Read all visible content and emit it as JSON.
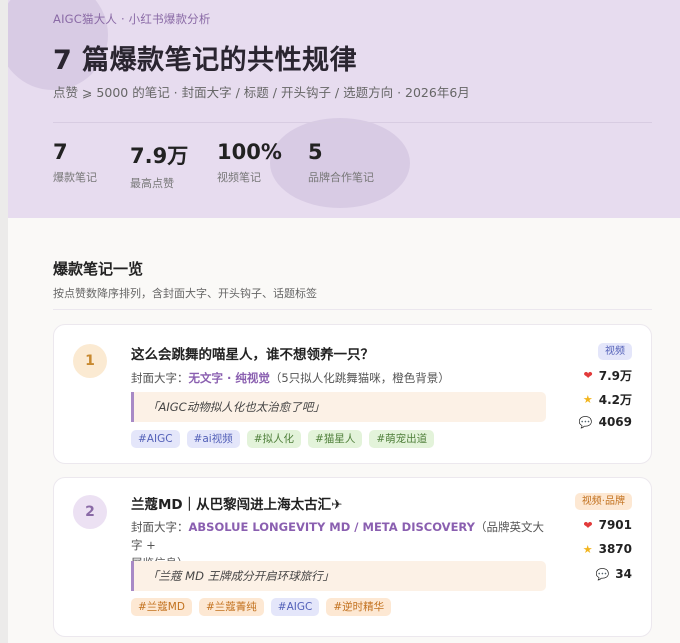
{
  "hero": {
    "kicker": "AIGC猫大人 · 小红书爆款分析",
    "title": "7 篇爆款笔记的共性规律",
    "subtitle": "点赞 ⩾ 5000 的笔记 · 封面大字 / 标题 / 开头钩子 / 选题方向 · 2026年6月",
    "stats": [
      {
        "num": "7",
        "label": "爆款笔记"
      },
      {
        "num": "7.9万",
        "label": "最高点赞"
      },
      {
        "num": "100%",
        "label": "视频笔记"
      },
      {
        "num": "5",
        "label": "品牌合作笔记"
      }
    ]
  },
  "section": {
    "title": "爆款笔记一览",
    "subtitle": "按点赞数降序排列，含封面大字、开头钩子、话题标签"
  },
  "notes": [
    {
      "rank": "1",
      "title": "这么会跳舞的喵星人，谁不想领养一只？",
      "cover_label": "封面大字：",
      "cover_value": "无文字 · 纯视觉",
      "cover_note": "（5只拟人化跳舞猫咪，橙色背景）",
      "hook": "「AIGC动物拟人化也太治愈了吧」",
      "tags": [
        "#AIGC",
        "#ai视频",
        "#拟人化",
        "#猫星人",
        "#萌宠出道"
      ],
      "badge": "视频",
      "likes": "7.9万",
      "favorites": "4.2万",
      "comments": "4069"
    },
    {
      "rank": "2",
      "title": "兰蔻MD｜从巴黎闯进上海太古汇✈",
      "cover_label": "封面大字：",
      "cover_value": "ABSOLUE LONGEVITY MD / META DISCOVERY",
      "cover_note": "（品牌英文大字 +",
      "cover_note2": "展览信息）",
      "hook": "「兰蔻 MD 王牌成分开启环球旅行」",
      "tags": [
        "#兰蔻MD",
        "#兰蔻菁纯",
        "#AIGC",
        "#逆时精华"
      ],
      "badge": "视频·品牌",
      "likes": "7901",
      "favorites": "3870",
      "comments": "34"
    }
  ],
  "colors": {
    "hero_bg": "#e7dcef",
    "accent_purple": "#8a6aa6",
    "tag_blue": "#5360b8",
    "tag_green": "#4f7f3a",
    "tag_orange": "#c2711e"
  },
  "icons": {
    "likes": "heart-icon",
    "favorites": "star-icon",
    "comments": "speech-bubble-icon"
  }
}
